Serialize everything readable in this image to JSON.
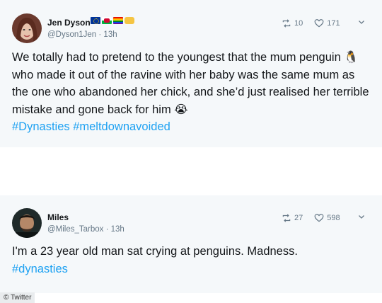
{
  "tweets": [
    {
      "name": "Jen Dyson",
      "handle": "@Dyson1Jen · 13h",
      "retweets": "10",
      "likes": "171",
      "text_parts": {
        "p1": "We totally had to pretend to the youngest that the mum penguin",
        "emoji1": "🐧",
        "p2": "who made it out of the ravine with her baby was the same mum as the one who abandoned her chick, and she’d just realised her terrible mistake and gone back for him",
        "emoji2": "😭",
        "tags": "#Dynasties #meltdownavoided"
      }
    },
    {
      "name": "Miles",
      "handle": "@Miles_Tarbox · 13h",
      "retweets": "27",
      "likes": "598",
      "text_parts": {
        "p1": "I'm a 23 year old man sat crying at penguins. Madness.",
        "tags": "#dynasties"
      }
    }
  ],
  "credit": "© Twitter",
  "colors": {
    "card_bg": "#f5f8fa",
    "link": "#1da1f2",
    "meta": "#657786"
  },
  "icons": {
    "retweet": "retweet-icon",
    "like": "heart-icon",
    "menu": "chevron-down-icon"
  }
}
